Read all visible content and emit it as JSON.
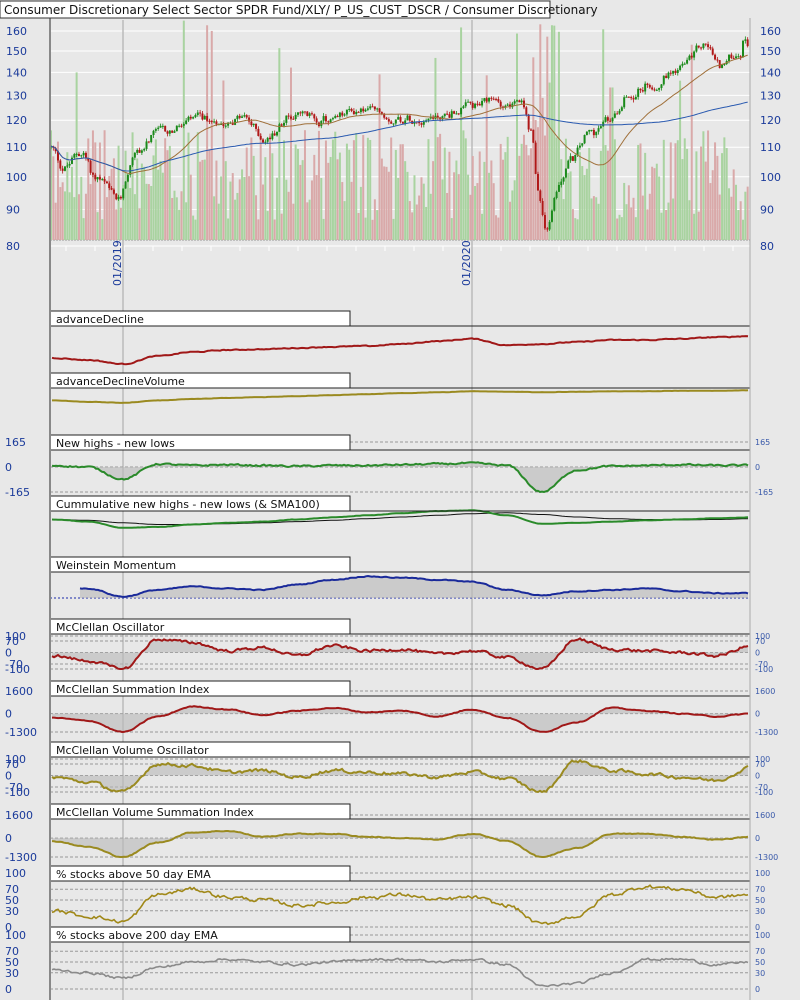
{
  "title": "Consumer Discretionary Select Sector SPDR Fund/XLY/ P_US_CUST_DSCR / Consumer Discretionary",
  "date_labels": [
    {
      "label": "01/2019",
      "t": 2019.0
    },
    {
      "label": "01/2020",
      "t": 2020.0
    }
  ],
  "colors": {
    "up": "#1a8a1a",
    "down": "#b01818",
    "vol_up": "#a9d3a0",
    "vol_down": "#d9a9a9",
    "ma_short": "#a0703a",
    "ma_long": "#2a5ab0"
  },
  "chart_data": [
    {
      "type": "candlestick",
      "name": "price",
      "title": "Consumer Discretionary Select Sector SPDR Fund/XLY/ P_US_CUST_DSCR / Consumer Discretionary",
      "y_ticks": [
        160,
        150,
        140,
        130,
        120,
        110,
        100,
        90,
        80
      ],
      "ylim": [
        80,
        160
      ],
      "scale": "log",
      "t": [
        2018.79,
        2018.83,
        2018.88,
        2018.92,
        2018.99,
        2019.01,
        2019.03,
        2019.11,
        2019.22,
        2019.34,
        2019.41,
        2019.48,
        2019.59,
        2019.68,
        2019.79,
        2019.91,
        2019.99,
        2020.08,
        2020.14,
        2020.17,
        2020.19,
        2020.21,
        2020.24,
        2020.28,
        2020.34,
        2020.4,
        2020.44,
        2020.51,
        2020.6,
        2020.67,
        2020.71,
        2020.77,
        2020.78,
        2020.8
      ],
      "close": [
        110,
        103,
        108,
        100,
        92,
        100,
        108,
        115,
        120,
        121,
        113,
        122,
        120,
        124,
        121,
        122,
        125,
        127,
        126,
        115,
        95,
        84,
        95,
        105,
        115,
        120,
        130,
        135,
        143,
        153,
        143,
        150,
        157,
        152
      ],
      "series": [
        {
          "name": "SMA50"
        },
        {
          "name": "SMA200"
        },
        {
          "name": "Volume"
        }
      ]
    },
    {
      "type": "line",
      "title": "advanceDecline",
      "color": "#a01818",
      "ylim": [
        -40,
        60
      ],
      "t_start": 2018.8,
      "t_step": 0.1,
      "values": [
        -10,
        -15,
        -25,
        -5,
        5,
        10,
        12,
        15,
        18,
        20,
        25,
        32,
        38,
        22,
        25,
        30,
        35,
        35,
        38,
        42,
        45
      ],
      "left_ticks": [],
      "right_ticks": []
    },
    {
      "type": "line",
      "title": "advanceDeclineVolume",
      "color": "#9a8a20",
      "ylim": [
        -20,
        30
      ],
      "t_start": 2018.8,
      "t_step": 0.1,
      "values": [
        0,
        -3,
        -5,
        0,
        3,
        5,
        7,
        9,
        11,
        13,
        15,
        17,
        19,
        18,
        17,
        18,
        19,
        19,
        20,
        20,
        21
      ],
      "left_ticks": [],
      "right_ticks": []
    },
    {
      "type": "line",
      "title": "New highs - new lows",
      "color": "#2a8a2a",
      "ylim": [
        -165,
        165
      ],
      "t_start": 2018.8,
      "t_step": 0.1,
      "values": [
        10,
        0,
        -80,
        20,
        10,
        15,
        10,
        5,
        10,
        10,
        15,
        20,
        25,
        10,
        -165,
        -20,
        5,
        10,
        15,
        10,
        10
      ],
      "left_ticks": [
        165,
        0,
        -165
      ],
      "right_ticks": [
        165,
        0,
        -165
      ]
    },
    {
      "type": "line",
      "title": "Cummulative new highs - new lows (& SMA100)",
      "color": "#2a8a2a",
      "ylim": [
        -30,
        30
      ],
      "t_start": 2018.8,
      "t_step": 0.1,
      "values": [
        0,
        -5,
        -20,
        -18,
        -12,
        -8,
        -5,
        0,
        5,
        10,
        15,
        20,
        22,
        10,
        -10,
        -8,
        -5,
        -2,
        0,
        3,
        5
      ],
      "sma_values": [
        0,
        -2,
        -8,
        -12,
        -12,
        -10,
        -8,
        -5,
        -2,
        2,
        6,
        10,
        14,
        16,
        12,
        6,
        2,
        0,
        -1,
        0,
        2
      ],
      "left_ticks": [],
      "right_ticks": []
    },
    {
      "type": "line",
      "title": "Weinstein Momentum",
      "color": "#1a2a9a",
      "ylim": [
        -5,
        35
      ],
      "t_start": 2018.8,
      "t_step": 0.1,
      "values": [
        15,
        12,
        0,
        10,
        15,
        12,
        10,
        18,
        25,
        30,
        28,
        25,
        22,
        10,
        2,
        8,
        10,
        12,
        8,
        5,
        5
      ],
      "left_ticks": [],
      "right_ticks": []
    },
    {
      "type": "line",
      "title": "McClellan Oscillator",
      "color": "#a01818",
      "ylim": [
        -100,
        100
      ],
      "t_start": 2018.8,
      "t_step": 0.1,
      "values": [
        -20,
        -50,
        -100,
        80,
        60,
        10,
        30,
        -20,
        40,
        10,
        20,
        -10,
        10,
        -30,
        -100,
        80,
        20,
        10,
        0,
        -20,
        40
      ],
      "left_ticks": [
        100,
        70,
        0,
        -70,
        -100
      ],
      "right_ticks": [
        100,
        70,
        0,
        -70,
        -100
      ]
    },
    {
      "type": "line",
      "title": "McClellan Summation Index",
      "color": "#a01818",
      "ylim": [
        -1300,
        1600
      ],
      "t_start": 2018.8,
      "t_step": 0.1,
      "values": [
        -300,
        -500,
        -1300,
        -200,
        500,
        300,
        -100,
        200,
        400,
        100,
        200,
        -200,
        300,
        -300,
        -1300,
        -600,
        400,
        200,
        0,
        -200,
        0
      ],
      "left_ticks": [
        1600,
        0,
        -1300
      ],
      "right_ticks": [
        1600,
        0,
        -1300
      ]
    },
    {
      "type": "line",
      "title": "McClellan Volume Oscillator",
      "color": "#9a8a20",
      "ylim": [
        -100,
        100
      ],
      "t_start": 2018.8,
      "t_step": 0.1,
      "values": [
        -10,
        -40,
        -100,
        70,
        60,
        20,
        30,
        -10,
        30,
        20,
        10,
        -10,
        20,
        -20,
        -100,
        90,
        30,
        10,
        -10,
        -30,
        50
      ],
      "left_ticks": [
        100,
        70,
        0,
        -70,
        -100
      ],
      "right_ticks": [
        100,
        70,
        0,
        -70,
        -100
      ]
    },
    {
      "type": "line",
      "title": "McClellan Volume Summation Index",
      "color": "#9a8a20",
      "ylim": [
        -1300,
        1600
      ],
      "t_start": 2018.8,
      "t_step": 0.1,
      "values": [
        -200,
        -600,
        -1300,
        -300,
        400,
        500,
        100,
        300,
        300,
        100,
        0,
        -100,
        300,
        -200,
        -1300,
        -700,
        300,
        300,
        100,
        -100,
        100
      ],
      "left_ticks": [
        1600,
        0,
        -1300
      ],
      "right_ticks": [
        1600,
        0,
        -1300
      ]
    },
    {
      "type": "line",
      "title": "% stocks above 50 day EMA",
      "color": "#a08818",
      "ylim": [
        0,
        100
      ],
      "t_start": 2018.8,
      "t_step": 0.1,
      "values": [
        30,
        20,
        10,
        60,
        70,
        55,
        50,
        40,
        45,
        55,
        60,
        50,
        55,
        40,
        5,
        20,
        60,
        75,
        70,
        55,
        60
      ],
      "left_ticks": [
        100,
        70,
        50,
        30,
        0
      ],
      "right_ticks": [
        100,
        70,
        50,
        30,
        0
      ]
    },
    {
      "type": "line",
      "title": "% stocks above 200 day EMA",
      "color": "#8a8a8a",
      "ylim": [
        0,
        100
      ],
      "t_start": 2018.8,
      "t_step": 0.1,
      "values": [
        35,
        30,
        20,
        40,
        50,
        55,
        50,
        45,
        50,
        55,
        55,
        50,
        55,
        45,
        5,
        10,
        30,
        55,
        55,
        45,
        50
      ],
      "left_ticks": [
        100,
        70,
        50,
        30,
        0
      ],
      "right_ticks": [
        100,
        70,
        50,
        30,
        0
      ]
    }
  ]
}
